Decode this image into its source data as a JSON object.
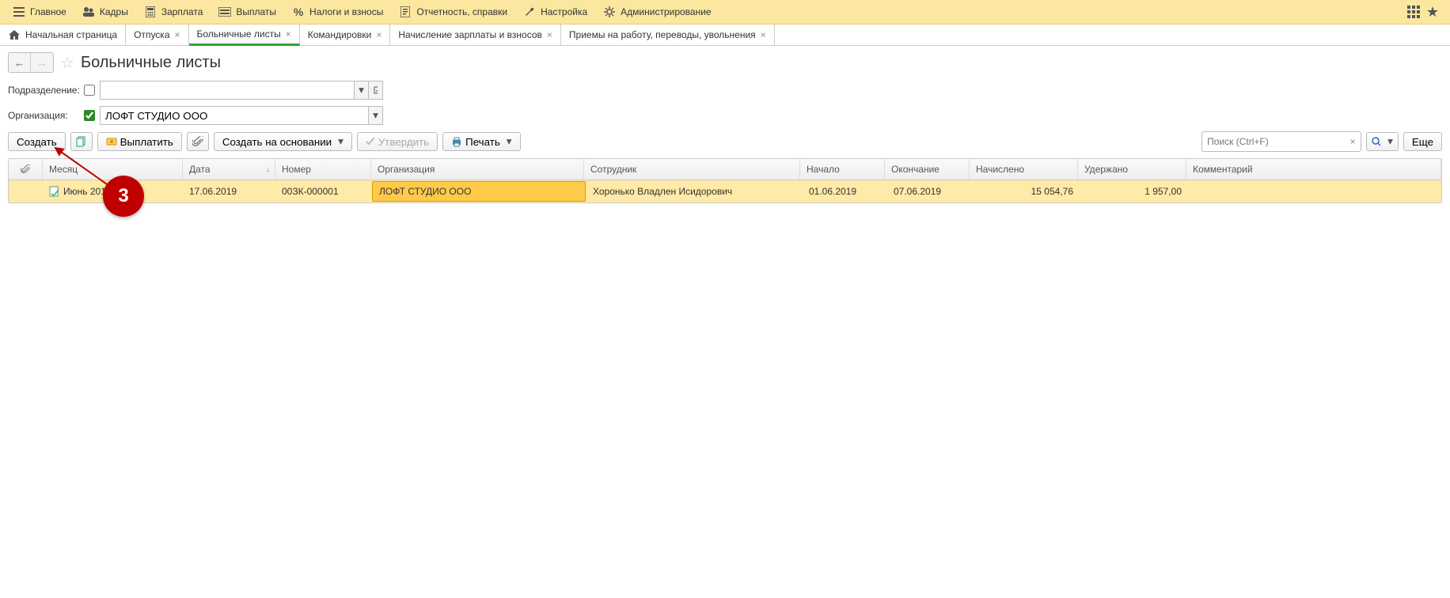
{
  "topmenu": [
    {
      "id": "main",
      "label": "Главное",
      "icon": "menu"
    },
    {
      "id": "hr",
      "label": "Кадры",
      "icon": "people"
    },
    {
      "id": "salary",
      "label": "Зарплата",
      "icon": "calc"
    },
    {
      "id": "payments",
      "label": "Выплаты",
      "icon": "wallet"
    },
    {
      "id": "taxes",
      "label": "Налоги и взносы",
      "icon": "percent"
    },
    {
      "id": "reports",
      "label": "Отчетность, справки",
      "icon": "report"
    },
    {
      "id": "settings",
      "label": "Настройка",
      "icon": "wrench"
    },
    {
      "id": "admin",
      "label": "Администрирование",
      "icon": "gear"
    }
  ],
  "tabs": [
    {
      "id": "home",
      "label": "Начальная страница",
      "closable": false,
      "home": true
    },
    {
      "id": "vac",
      "label": "Отпуска",
      "closable": true
    },
    {
      "id": "sick",
      "label": "Больничные листы",
      "closable": true,
      "active": true
    },
    {
      "id": "trip",
      "label": "Командировки",
      "closable": true
    },
    {
      "id": "accr",
      "label": "Начисление зарплаты и взносов",
      "closable": true
    },
    {
      "id": "hire",
      "label": "Приемы на работу, переводы, увольнения",
      "closable": true
    }
  ],
  "page_title": "Больничные листы",
  "filters": {
    "department_label": "Подразделение:",
    "department_value": "",
    "organization_label": "Организация:",
    "organization_value": "ЛОФТ СТУДИО ООО",
    "organization_checked": true
  },
  "toolbar": {
    "create": "Создать",
    "pay": "Выплатить",
    "create_based": "Создать на основании",
    "approve": "Утвердить",
    "print": "Печать",
    "more": "Еще"
  },
  "search_placeholder": "Поиск (Ctrl+F)",
  "columns": {
    "attach": "",
    "month": "Месяц",
    "date": "Дата",
    "number": "Номер",
    "org": "Организация",
    "emp": "Сотрудник",
    "start": "Начало",
    "end": "Окончание",
    "accrued": "Начислено",
    "deducted": "Удержано",
    "comment": "Комментарий"
  },
  "rows": [
    {
      "month": "Июнь 2019",
      "date": "17.06.2019",
      "number": "00ЗК-000001",
      "org": "ЛОФТ СТУДИО ООО",
      "emp": "Хоронько Владлен Исидорович",
      "start": "01.06.2019",
      "end": "07.06.2019",
      "accrued": "15 054,76",
      "deducted": "1 957,00",
      "comment": ""
    }
  ],
  "callout_number": "3"
}
